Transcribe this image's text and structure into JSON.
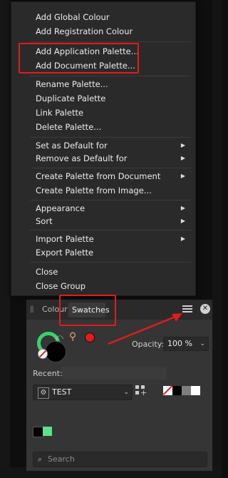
{
  "menu": {
    "items": [
      {
        "label": "Add Global Colour",
        "submenu": false
      },
      {
        "label": "Add Registration Colour",
        "submenu": false
      },
      {
        "label": "Add Application Palette...",
        "submenu": false
      },
      {
        "label": "Add Document Palette...",
        "submenu": false
      },
      {
        "label": "Rename Palette...",
        "submenu": false
      },
      {
        "label": "Duplicate Palette",
        "submenu": false
      },
      {
        "label": "Link Palette",
        "submenu": false
      },
      {
        "label": "Delete Palette...",
        "submenu": false
      },
      {
        "label": "Set as Default for",
        "submenu": true
      },
      {
        "label": "Remove as Default for",
        "submenu": true
      },
      {
        "label": "Create Palette from Document",
        "submenu": true
      },
      {
        "label": "Create Palette from Image...",
        "submenu": false
      },
      {
        "label": "Appearance",
        "submenu": true
      },
      {
        "label": "Sort",
        "submenu": true
      },
      {
        "label": "Import Palette",
        "submenu": true
      },
      {
        "label": "Export Palette",
        "submenu": false
      },
      {
        "label": "Close",
        "submenu": false
      },
      {
        "label": "Close Group",
        "submenu": false
      }
    ],
    "submenu_arrow": "▶"
  },
  "panel": {
    "tabs": {
      "colour": "Colour",
      "swatches": "Swatches"
    },
    "close_glyph": "✕",
    "opacity_label": "Opacity:",
    "opacity_value": "100 %",
    "recent_label": "Recent:",
    "palette_name": "TEST",
    "search_placeholder": "Search",
    "fill_ring_color": "#37d26b",
    "fill_color": "#000000",
    "picker_color": "#e31b1b",
    "palette_swatches": [
      "none",
      "#000000",
      "#7f7f7f",
      "#ffffff"
    ],
    "document_swatches": [
      "#000000",
      "#5fe08a"
    ]
  },
  "annotation": {
    "color": "#e31b1b"
  }
}
